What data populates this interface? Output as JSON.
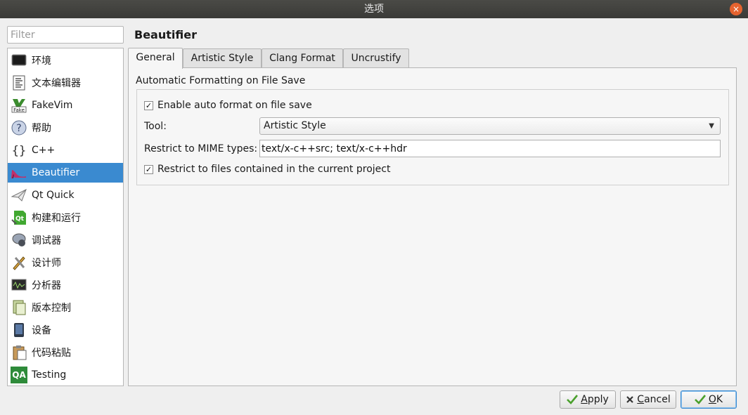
{
  "window": {
    "title": "选项",
    "close_glyph": "×"
  },
  "filter": {
    "placeholder": "Filter",
    "value": ""
  },
  "nav": {
    "selected_index": 5,
    "items": [
      {
        "label": "环境",
        "icon": "monitor-icon"
      },
      {
        "label": "文本编辑器",
        "icon": "text-document-icon"
      },
      {
        "label": "FakeVim",
        "icon": "fakevim-icon"
      },
      {
        "label": "帮助",
        "icon": "help-icon"
      },
      {
        "label": "C++",
        "icon": "braces-icon"
      },
      {
        "label": "Beautifier",
        "icon": "high-heel-icon"
      },
      {
        "label": "Qt Quick",
        "icon": "paper-plane-icon"
      },
      {
        "label": "构建和运行",
        "icon": "qt-build-icon"
      },
      {
        "label": "调试器",
        "icon": "debugger-bug-icon"
      },
      {
        "label": "设计师",
        "icon": "designer-tools-icon"
      },
      {
        "label": "分析器",
        "icon": "oscilloscope-icon"
      },
      {
        "label": "版本控制",
        "icon": "version-control-icon"
      },
      {
        "label": "设备",
        "icon": "device-tablet-icon"
      },
      {
        "label": "代码粘贴",
        "icon": "clipboard-icon"
      },
      {
        "label": "Testing",
        "icon": "qa-icon",
        "badge": "QA"
      }
    ]
  },
  "page": {
    "title": "Beautifier"
  },
  "tabs": [
    {
      "label": "General",
      "active": true
    },
    {
      "label": "Artistic Style",
      "active": false
    },
    {
      "label": "Clang Format",
      "active": false
    },
    {
      "label": "Uncrustify",
      "active": false
    }
  ],
  "general": {
    "section_label": "Automatic Formatting on File Save",
    "enable_auto_format": {
      "label": "Enable auto format on file save",
      "checked": true
    },
    "tool": {
      "label": "Tool:",
      "value": "Artistic Style"
    },
    "mime": {
      "label": "Restrict to MIME types:",
      "value": "text/x-c++src; text/x-c++hdr"
    },
    "restrict_project": {
      "label": "Restrict to files contained in the current project",
      "checked": true
    },
    "check_glyph": "✓",
    "dropdown_glyph": "▼"
  },
  "buttons": {
    "apply": {
      "mnemonic": "A",
      "rest": "pply"
    },
    "cancel": {
      "mnemonic": "C",
      "rest": "ancel"
    },
    "ok": {
      "mnemonic": "O",
      "rest": "K"
    }
  },
  "colors": {
    "selection": "#3a8ad0",
    "titlebar": "#3e3e3b",
    "close": "#e5632f"
  }
}
